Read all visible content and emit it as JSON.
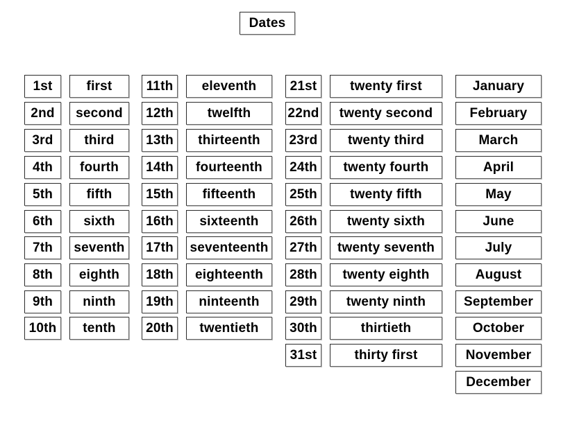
{
  "title": "Dates",
  "columns": [
    {
      "name": "ordinal-numbers-1-10",
      "items": [
        "1st",
        "2nd",
        "3rd",
        "4th",
        "5th",
        "6th",
        "7th",
        "8th",
        "9th",
        "10th"
      ]
    },
    {
      "name": "ordinal-words-1-10",
      "items": [
        "first",
        "second",
        "third",
        "fourth",
        "fifth",
        "sixth",
        "seventh",
        "eighth",
        "ninth",
        "tenth"
      ]
    },
    {
      "name": "ordinal-numbers-11-20",
      "items": [
        "11th",
        "12th",
        "13th",
        "14th",
        "15th",
        "16th",
        "17th",
        "18th",
        "19th",
        "20th"
      ]
    },
    {
      "name": "ordinal-words-11-20",
      "items": [
        "eleventh",
        "twelfth",
        "thirteenth",
        "fourteenth",
        "fifteenth",
        "sixteenth",
        "seventeenth",
        "eighteenth",
        "ninteenth",
        "twentieth"
      ]
    },
    {
      "name": "ordinal-numbers-21-31",
      "items": [
        "21st",
        "22nd",
        "23rd",
        "24th",
        "25th",
        "26th",
        "27th",
        "28th",
        "29th",
        "30th",
        "31st"
      ]
    },
    {
      "name": "ordinal-words-21-31",
      "items": [
        "twenty first",
        "twenty second",
        "twenty third",
        "twenty fourth",
        "twenty fifth",
        "twenty sixth",
        "twenty seventh",
        "twenty eighth",
        "twenty ninth",
        "thirtieth",
        "thirty first"
      ]
    },
    {
      "name": "months",
      "items": [
        "January",
        "February",
        "March",
        "April",
        "May",
        "June",
        "July",
        "August",
        "September",
        "October",
        "November",
        "December"
      ]
    }
  ]
}
